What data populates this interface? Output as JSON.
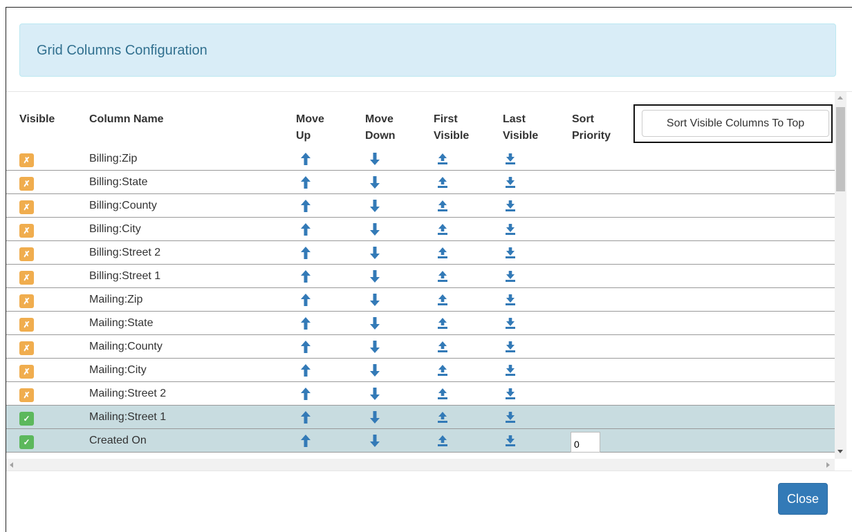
{
  "modal": {
    "title": "Grid Columns Configuration",
    "close_x": "×",
    "close_button": "Close"
  },
  "grid": {
    "headers": {
      "visible": "Visible",
      "column_name": "Column Name",
      "move_up": [
        "Move",
        "Up"
      ],
      "move_down": [
        "Move",
        "Down"
      ],
      "first_visible": [
        "First",
        "Visible"
      ],
      "last_visible": [
        "Last",
        "Visible"
      ],
      "sort_priority": [
        "Sort",
        "Priority"
      ]
    },
    "sort_button": "Sort Visible Columns To Top",
    "rows": [
      {
        "name": "Billing:Zip",
        "visible": false
      },
      {
        "name": "Billing:State",
        "visible": false
      },
      {
        "name": "Billing:County",
        "visible": false
      },
      {
        "name": "Billing:City",
        "visible": false
      },
      {
        "name": "Billing:Street 2",
        "visible": false
      },
      {
        "name": "Billing:Street 1",
        "visible": false
      },
      {
        "name": "Mailing:Zip",
        "visible": false
      },
      {
        "name": "Mailing:State",
        "visible": false
      },
      {
        "name": "Mailing:County",
        "visible": false
      },
      {
        "name": "Mailing:City",
        "visible": false
      },
      {
        "name": "Mailing:Street 2",
        "visible": false
      },
      {
        "name": "Mailing:Street 1",
        "visible": true
      },
      {
        "name": "Created On",
        "visible": true,
        "sort_priority": "0"
      }
    ]
  },
  "icons": {
    "visible_on": "check-icon",
    "visible_off": "x-icon",
    "move_up": "arrow-up-icon",
    "move_down": "arrow-down-icon",
    "first_visible": "upload-icon",
    "last_visible": "download-icon"
  },
  "colors": {
    "header_bg": "#d9edf7",
    "header_text": "#31708f",
    "off_badge": "#f0ad4e",
    "on_badge": "#5cb85c",
    "icon": "#337ab7",
    "selected_row": "#c8dce0",
    "primary_button": "#337ab7"
  }
}
